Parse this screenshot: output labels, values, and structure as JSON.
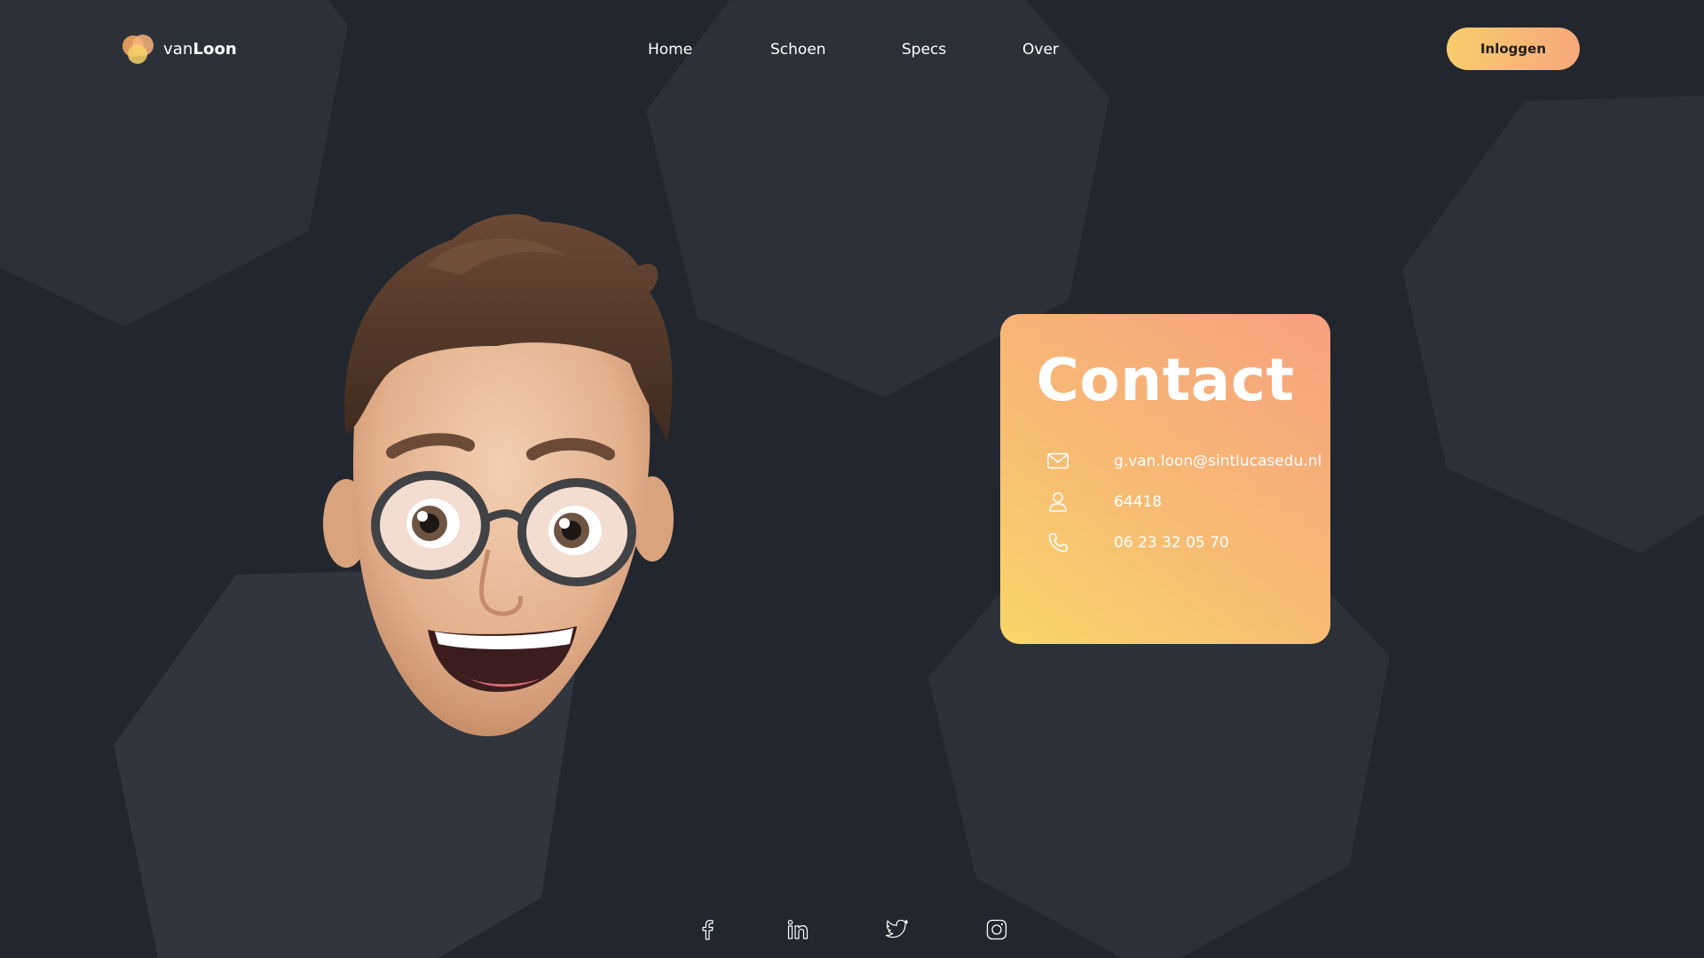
{
  "header": {
    "logo_prefix": "van",
    "logo_bold": "Loon",
    "nav": [
      "Home",
      "Schoen",
      "Specs",
      "Over"
    ],
    "login_label": "Inloggen"
  },
  "contact": {
    "title": "Contact",
    "email": "g.van.loon@sintlucasedu.nl",
    "id": "64418",
    "phone": "06 23 32 05 70",
    "icons": [
      "mail-icon",
      "user-icon",
      "phone-icon"
    ]
  },
  "social": [
    "facebook-icon",
    "linkedin-icon",
    "twitter-icon",
    "instagram-icon"
  ],
  "colors": {
    "background": "#22262e",
    "shape": "#2c3139",
    "accent_yellow": "#f8d668",
    "accent_peach": "#f6a17e"
  }
}
